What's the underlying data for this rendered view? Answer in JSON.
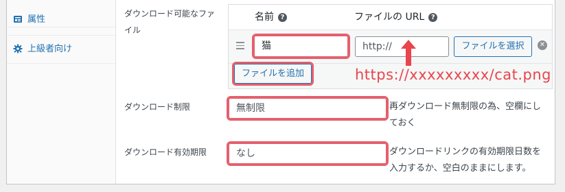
{
  "tabs": [
    {
      "label": "属性",
      "icon": "table-icon"
    },
    {
      "label": "上級者向け",
      "icon": "gear-icon"
    }
  ],
  "downloadable_files": {
    "label_line1": "ダウンロード可能なファ",
    "label_line2": "イル",
    "col_name": "名前",
    "col_url": "ファイルの URL",
    "file_name_value": "猫",
    "file_url_placeholder": "http://",
    "choose_file_button": "ファイルを選択",
    "add_file_button": "ファイルを追加"
  },
  "annotation": {
    "url_text": "https://xxxxxxxxx/cat.png",
    "color": "#e8454c"
  },
  "download_limit": {
    "label": "ダウンロード制限",
    "placeholder": "無制限",
    "note_line1": "再ダウンロード無制限の為、空欄にし",
    "note_line2": "ておく"
  },
  "download_expiry": {
    "label": "ダウンロード有効期限",
    "placeholder": "なし",
    "note_line1": "ダウンロードリンクの有効期限日数を",
    "note_line2": "入力するか、空白のままにします。"
  },
  "colors": {
    "link": "#2271b1",
    "highlight": "#e4606d"
  }
}
